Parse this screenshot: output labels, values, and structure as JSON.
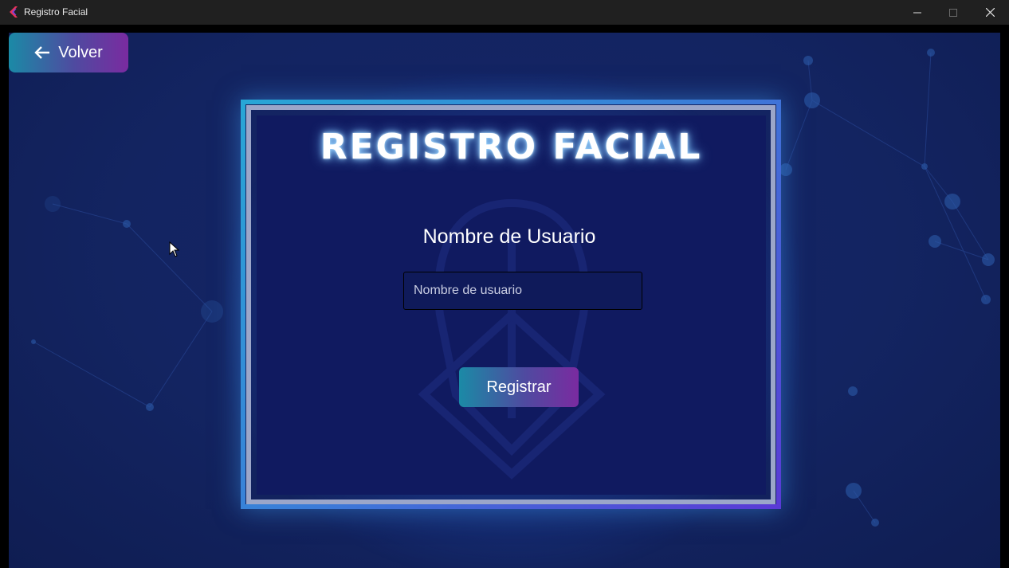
{
  "window": {
    "title": "Registro Facial",
    "icon": "app-logo-icon",
    "controls": [
      "minimize-icon",
      "maximize-icon",
      "close-icon"
    ]
  },
  "back": {
    "label": "Volver",
    "icon": "arrow-left-icon"
  },
  "main": {
    "heading": "REGISTRO FACIAL",
    "username_label": "Nombre de Usuario",
    "username_placeholder": "Nombre de usuario",
    "username_value": "",
    "submit_label": "Registrar"
  },
  "colors": {
    "background": "#132461",
    "panel": "#101a60",
    "button_gradient_start": "#1b8aa6",
    "button_gradient_end": "#7a2ba0",
    "frame_glow": "#28a6d6"
  }
}
